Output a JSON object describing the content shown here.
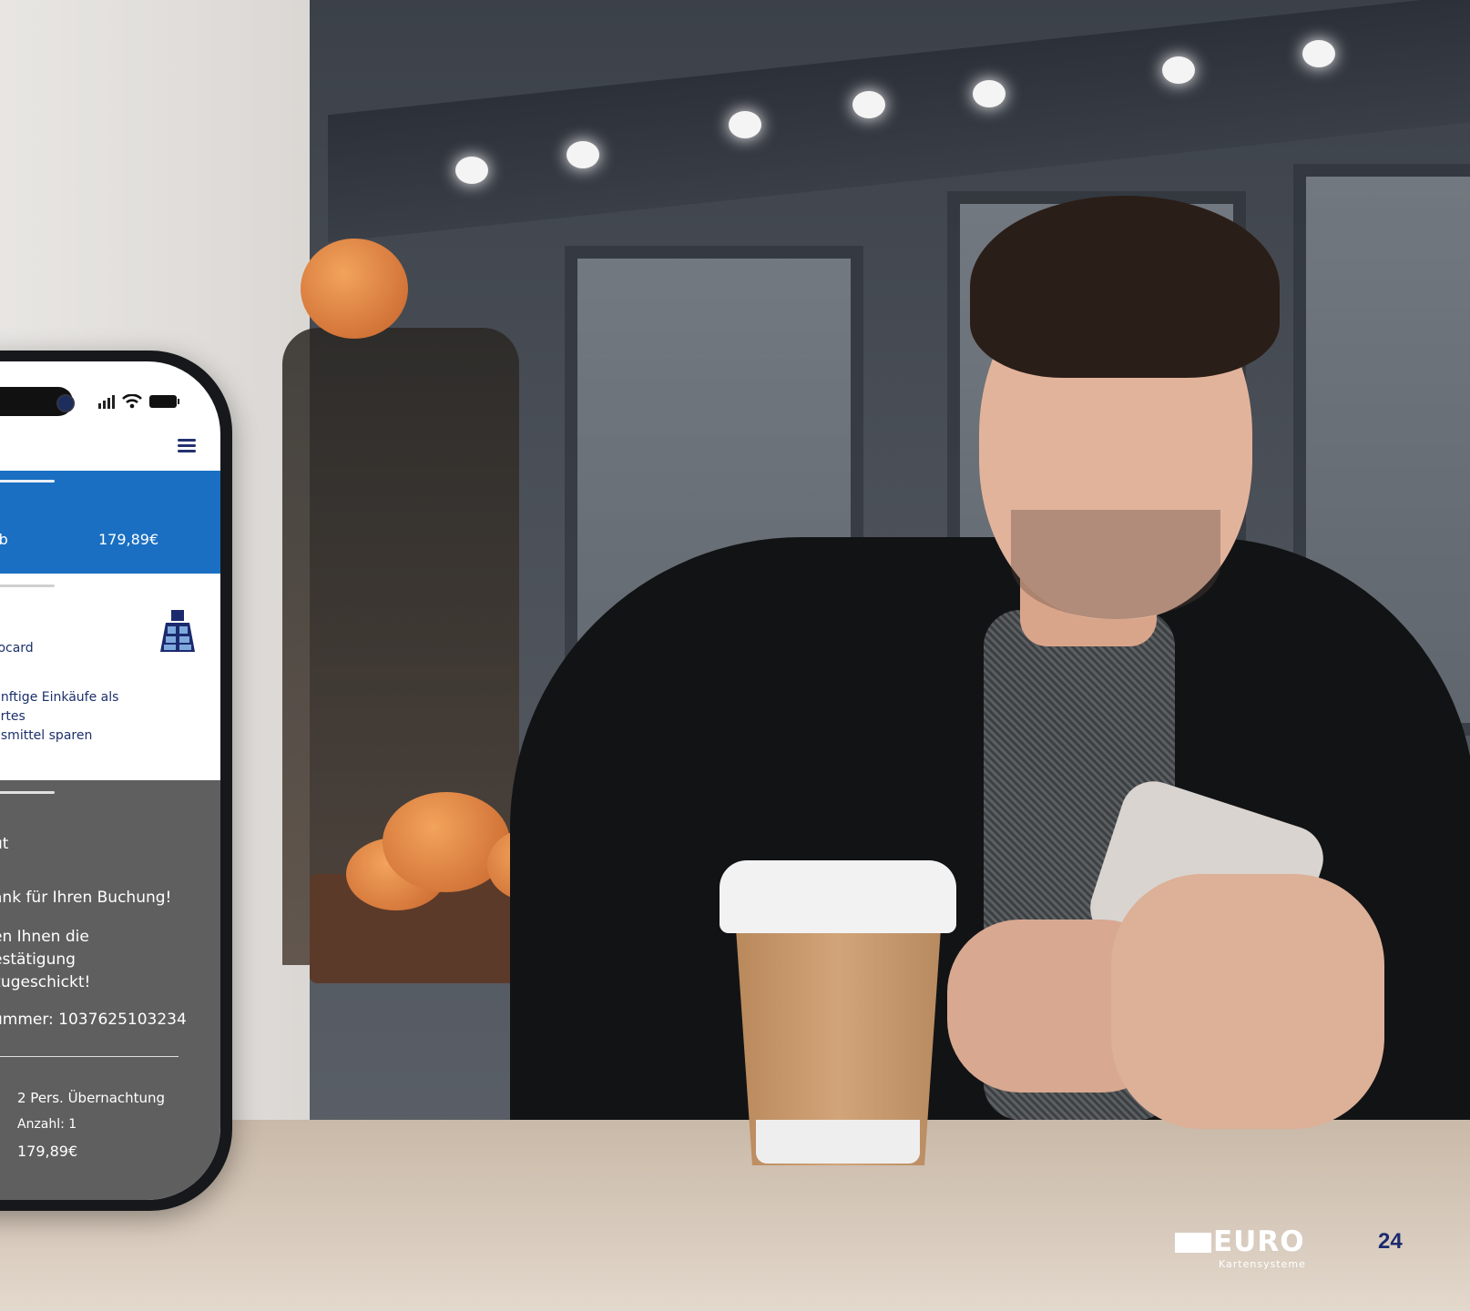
{
  "phone": {
    "cart": {
      "label": "rb",
      "price": "179,89€"
    },
    "payment": {
      "label": "rocard",
      "note_lines": [
        "ünftige Einkäufe als",
        "ertes",
        "gsmittel sparen"
      ]
    },
    "confirmation": {
      "title": "ut",
      "thanks": "ank für Ihren Buchung!",
      "text_lines": [
        "en Ihnen die",
        "estätigung",
        "zugeschickt!"
      ],
      "order_number": "ummer:  1037625103234",
      "item_name": "2 Pers. Übernachtung",
      "item_qty": "Anzahl: 1",
      "item_price": "179,89€"
    }
  },
  "brand": {
    "word": "EURO",
    "subtitle": "Kartensysteme"
  },
  "page_number": "24",
  "colors": {
    "primary_blue": "#1a6fc2",
    "dark_navy": "#1b2a6e",
    "gray_section": "#5f5f5f"
  },
  "icons": [
    "signal-icon",
    "wifi-icon",
    "battery-icon",
    "menu-icon",
    "girocard-icon"
  ]
}
